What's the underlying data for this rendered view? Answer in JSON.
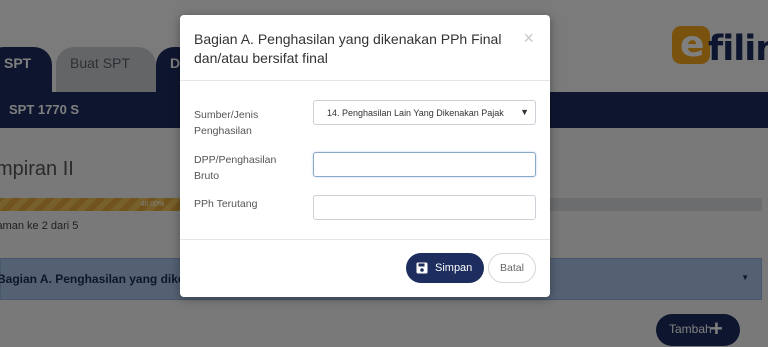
{
  "tabs": [
    {
      "label": "SPT"
    },
    {
      "label": "Buat SPT"
    },
    {
      "label": "D"
    }
  ],
  "logo": {
    "mark": "e",
    "text": "filing"
  },
  "navbar": {
    "label": "SPT 1770 S"
  },
  "page": {
    "title": "mpiran II",
    "progress": {
      "percent": 40,
      "label": "40.00%"
    },
    "page_info": "laman ke 2 dari 5",
    "section_label": "Bagian A. Penghasilan yang diken",
    "add_button": {
      "label": "Tambah",
      "icon": "plus-icon"
    }
  },
  "modal": {
    "title": "Bagian A. Penghasilan yang dikenakan PPh Final dan/atau bersifat final",
    "close_symbol": "×",
    "fields": {
      "source": {
        "label": "Sumber/Jenis Penghasilan",
        "selected": "14. Penghasilan Lain Yang Dikenakan Pajak"
      },
      "dpp": {
        "label": "DPP/Penghasilan Bruto",
        "value": ""
      },
      "pph": {
        "label": "PPh Terutang",
        "value": ""
      }
    },
    "buttons": {
      "save": {
        "label": "Simpan",
        "icon": "floppy-disk-icon"
      },
      "cancel": {
        "label": "Batal"
      }
    }
  },
  "colors": {
    "navy": "#1d2d5e",
    "accent_orange": "#f2a61c",
    "section_blue": "#a9c2e6"
  }
}
